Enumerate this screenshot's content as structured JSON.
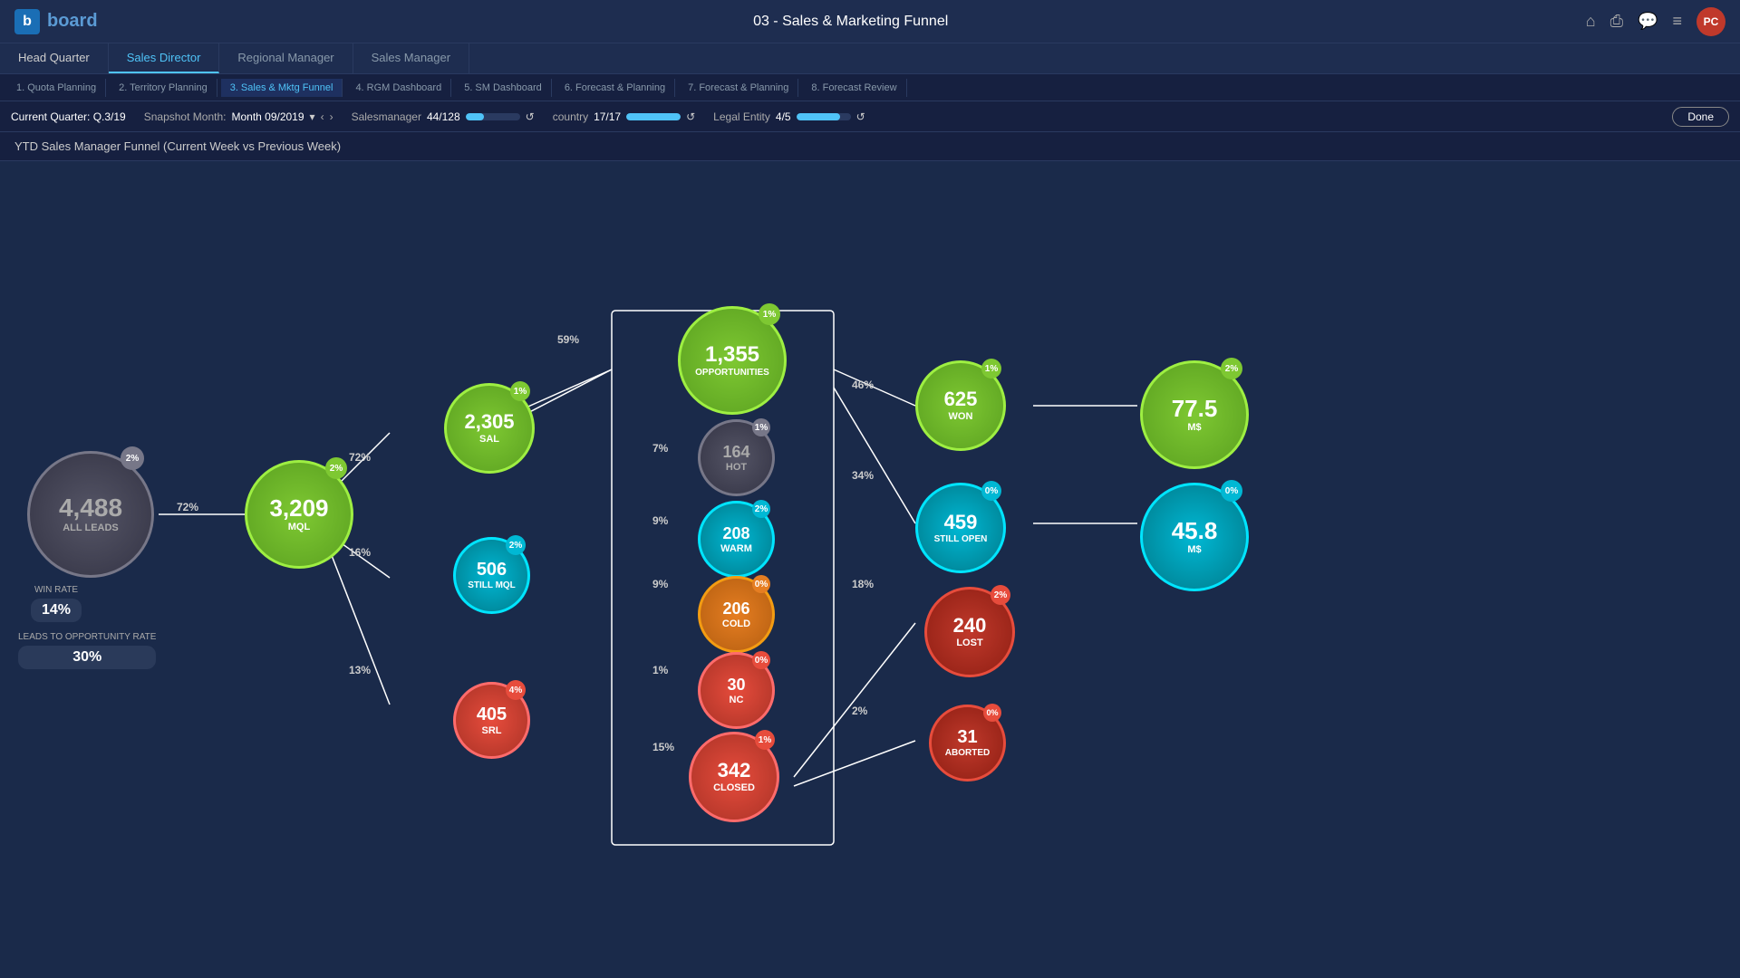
{
  "app": {
    "logo_b": "b",
    "logo_text": "board",
    "page_title": "03 - Sales & Marketing Funnel",
    "user_initials": "PC"
  },
  "nav": {
    "tabs": [
      {
        "id": "hq",
        "label": "Head Quarter",
        "active": false,
        "class": "head"
      },
      {
        "id": "sd",
        "label": "Sales Director",
        "active": true
      },
      {
        "id": "rm",
        "label": "Regional Manager",
        "active": false
      },
      {
        "id": "sm",
        "label": "Sales Manager",
        "active": false
      }
    ],
    "sub_tabs": [
      {
        "label": "1. Quota Planning"
      },
      {
        "label": "2. Territory Planning"
      },
      {
        "label": "3. Sales & Mktg Funnel",
        "active": true
      },
      {
        "label": "4. RGM Dashboard"
      },
      {
        "label": "5. SM Dashboard"
      },
      {
        "label": "6. Forecast & Planning"
      },
      {
        "label": "7. Forecast & Planning"
      },
      {
        "label": "8. Forecast Review"
      }
    ]
  },
  "filters": {
    "quarter_label": "Current Quarter: Q.3/19",
    "snapshot_label": "Snapshot Month:",
    "snapshot_value": "Month 09/2019",
    "salesmanager_label": "Salesmanager",
    "salesmanager_value": "44/128",
    "salesmanager_pct": 34,
    "country_label": "country",
    "country_value": "17/17",
    "country_pct": 100,
    "legal_entity_label": "Legal Entity",
    "legal_entity_value": "4/5",
    "legal_entity_pct": 80,
    "done_label": "Done"
  },
  "chart": {
    "title": "YTD Sales Manager Funnel (Current Week vs Previous Week)",
    "nodes": {
      "all_leads": {
        "value": "4,488",
        "label": "ALL LEADS",
        "badge": "2%",
        "type": "gray"
      },
      "mql": {
        "value": "3,209",
        "label": "MQL",
        "badge": "2%",
        "type": "lime"
      },
      "sal": {
        "value": "2,305",
        "label": "SAL",
        "badge": "1%",
        "type": "lime"
      },
      "still_mql": {
        "value": "506",
        "label": "Still MQL",
        "badge": "2%",
        "type": "cyan"
      },
      "srl": {
        "value": "405",
        "label": "SRL",
        "badge": "4%",
        "type": "red"
      },
      "opportunities": {
        "value": "1,355",
        "label": "Opportunities",
        "badge": "1%",
        "type": "lime"
      },
      "hot": {
        "value": "164",
        "label": "HOT",
        "badge": "1%",
        "type": "gray"
      },
      "warm": {
        "value": "208",
        "label": "Warm",
        "badge": "2%",
        "type": "cyan"
      },
      "cold": {
        "value": "206",
        "label": "Cold",
        "badge": "0%",
        "type": "orange"
      },
      "nc": {
        "value": "30",
        "label": "NC",
        "badge": "0%",
        "type": "red"
      },
      "closed": {
        "value": "342",
        "label": "CLOSED",
        "badge": "1%",
        "type": "red"
      },
      "won": {
        "value": "625",
        "label": "WON",
        "badge": "1%",
        "type": "lime"
      },
      "still_open": {
        "value": "459",
        "label": "STILL OPEN",
        "badge": "0%",
        "type": "cyan"
      },
      "lost": {
        "value": "240",
        "label": "LOST",
        "badge": "2%",
        "type": "red"
      },
      "aborted": {
        "value": "31",
        "label": "ABORTED",
        "badge": "0%",
        "type": "red"
      },
      "won_ms": {
        "value": "77.5",
        "label": "M$",
        "badge": "2%",
        "type": "lime"
      },
      "still_open_ms": {
        "value": "45.8",
        "label": "M$",
        "badge": "0%",
        "type": "cyan"
      }
    },
    "percentages": {
      "mql_pct": "72%",
      "sal_pct": "72%",
      "still_mql_pct": "16%",
      "srl_pct": "13%",
      "opp_pct": "59%",
      "hot_pct": "7%",
      "warm_pct": "9%",
      "cold_pct": "9%",
      "nc_pct": "1%",
      "closed_pct": "15%",
      "won_pct": "46%",
      "still_open_pct": "34%",
      "lost_pct": "18%",
      "aborted_pct": "2%"
    },
    "stats": {
      "win_rate_label": "WIN RATE",
      "win_rate_value": "14%",
      "leads_opp_label": "LEADS TO OPPORTUNITY RATE",
      "leads_opp_value": "30%"
    }
  },
  "icons": {
    "home": "⌂",
    "print": "⎙",
    "chat": "💬",
    "menu": "≡",
    "prev": "‹",
    "next": "›",
    "refresh": "↺",
    "dropdown": "▾"
  }
}
